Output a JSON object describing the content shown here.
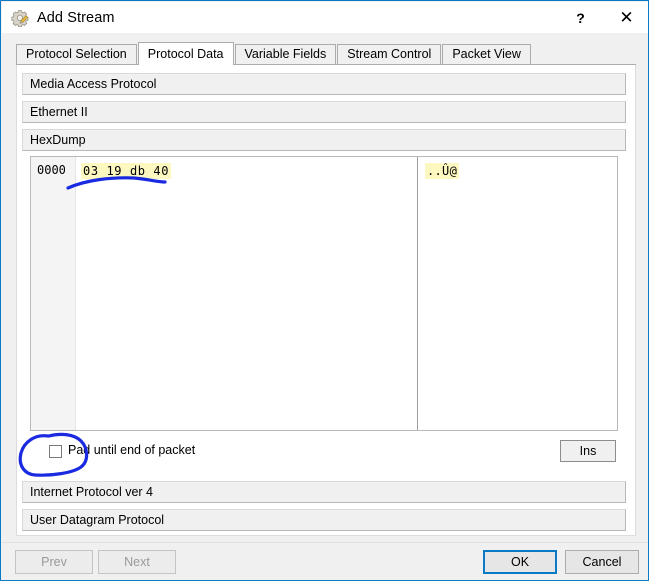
{
  "window": {
    "title": "Add Stream",
    "icon": "gear-pencil-icon",
    "help_label": "?",
    "close_label": "✕",
    "border_color": "#0a7ac6"
  },
  "tabs": [
    {
      "label": "Protocol Selection",
      "active": false
    },
    {
      "label": "Protocol Data",
      "active": true
    },
    {
      "label": "Variable Fields",
      "active": false
    },
    {
      "label": "Stream Control",
      "active": false
    },
    {
      "label": "Packet View",
      "active": false
    }
  ],
  "sections": {
    "media_access_protocol": "Media Access Protocol",
    "ethernet_ii": "Ethernet II",
    "hexdump": "HexDump",
    "internet_protocol_ver_4": "Internet Protocol ver 4",
    "user_datagram_protocol": "User Datagram Protocol"
  },
  "hexdump": {
    "offset": "0000",
    "bytes": "03 19 db 40",
    "ascii": "..Û@",
    "highlight_color": "#fdf8c0"
  },
  "pad": {
    "label": "Pad until end of packet",
    "checked": false
  },
  "insert": {
    "label": "Ins"
  },
  "footer": {
    "prev_label": "Prev",
    "next_label": "Next",
    "ok_label": "OK",
    "cancel_label": "Cancel"
  },
  "annotations": {
    "color": "#1a2ae0",
    "underline_target": "hex bytes 03 19 db 40",
    "circle_target": "Pad until end of packet checkbox"
  }
}
